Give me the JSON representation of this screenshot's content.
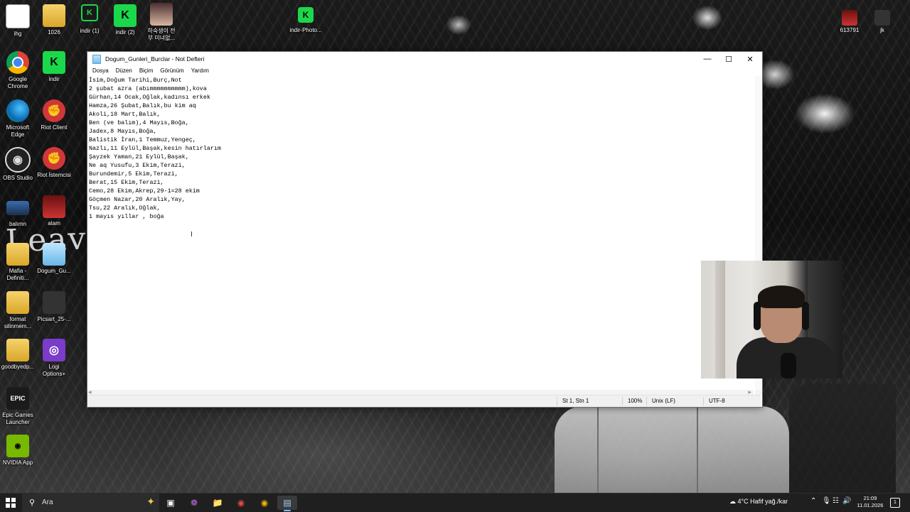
{
  "desktop": {
    "icons": [
      {
        "label": "ihg",
        "icon": "document-icon"
      },
      {
        "label": "1026",
        "icon": "folder-icon"
      },
      {
        "label": "indir (1)",
        "icon": "kick-icon"
      },
      {
        "label": "indir (2)",
        "icon": "kick-icon"
      },
      {
        "label": "하숙생이 전\n부 미녀없...",
        "icon": "photo-icon"
      },
      {
        "label": "indir-Photo...",
        "icon": "kick-icon"
      },
      {
        "label": "Google\nChrome",
        "icon": "chrome-icon"
      },
      {
        "label": "indir",
        "icon": "kick-icon"
      },
      {
        "label": "Microsoft\nEdge",
        "icon": "edge-icon"
      },
      {
        "label": "Riot Client",
        "icon": "riot-icon"
      },
      {
        "label": "OBS Studio",
        "icon": "obs-icon"
      },
      {
        "label": "Riot İstemcisi",
        "icon": "riot-icon"
      },
      {
        "label": "balımn",
        "icon": "photo-icon"
      },
      {
        "label": "atam",
        "icon": "photo-icon"
      },
      {
        "label": "Mafia -\nDefiniti...",
        "icon": "game-icon"
      },
      {
        "label": "Dogum_Gu...",
        "icon": "notepad-icon"
      },
      {
        "label": "format\nsilinmem...",
        "icon": "folder-icon"
      },
      {
        "label": "Picsart_25-...",
        "icon": "photo-icon"
      },
      {
        "label": "goodbyedp...",
        "icon": "folder-icon"
      },
      {
        "label": "Logi\nOptions+",
        "icon": "logi-icon"
      },
      {
        "label": "Epic Games\nLauncher",
        "icon": "epic-icon"
      },
      {
        "label": "NVIDIA App",
        "icon": "nvidia-icon"
      },
      {
        "label": "613791",
        "icon": "photo-icon"
      },
      {
        "label": "jk",
        "icon": "photo-icon"
      }
    ],
    "wallpaper_text": "Leave"
  },
  "notepad": {
    "title": "Dogum_Gunleri_Burclar - Not Defteri",
    "menu": [
      "Dosya",
      "Düzen",
      "Biçim",
      "Görünüm",
      "Yardım"
    ],
    "lines": [
      "İsim,Doğum Tarihi,Burç,Not",
      "2 şubat azra (abımmmmmmmmmm),kova",
      "Gürhan,14 Ocak,Oğlak,kadınsı erkek",
      "Hamza,26 Şubat,Balık,bu kim aq",
      "Akoli,18 Mart,Balık,",
      "Ben (ve balım),4 Mayıs,Boğa,",
      "Jadex,8 Mayıs,Boğa,",
      "Balistik İran,1 Temmuz,Yengeç,",
      "Nazlı,11 Eylül,Başak,kesin hatırlarım",
      "Şayzek Yaman,21 Eylül,Başak,",
      "Ne aq Yusufu,3 Ekim,Terazi,",
      "Burundemir,5 Ekim,Terazi,",
      "Berat,15 Ekim,Terazi,",
      "Cemo,28 Ekim,Akrep,29-1=28 ekim",
      "Göçmen Nazar,20 Aralık,Yay,",
      "Tsu,22 Aralık,Oğlak,",
      "1 mayıs yıllar , boğa"
    ],
    "status": {
      "position": "St 1, Stn 1",
      "zoom": "100%",
      "line_ending": "Unix (LF)",
      "encoding": "UTF-8"
    }
  },
  "taskbar": {
    "search_placeholder": "Ara",
    "weather": "4°C  Hafif yağ./kar",
    "time": "21:09",
    "date": "11.01.2026",
    "notification_count": "1"
  }
}
